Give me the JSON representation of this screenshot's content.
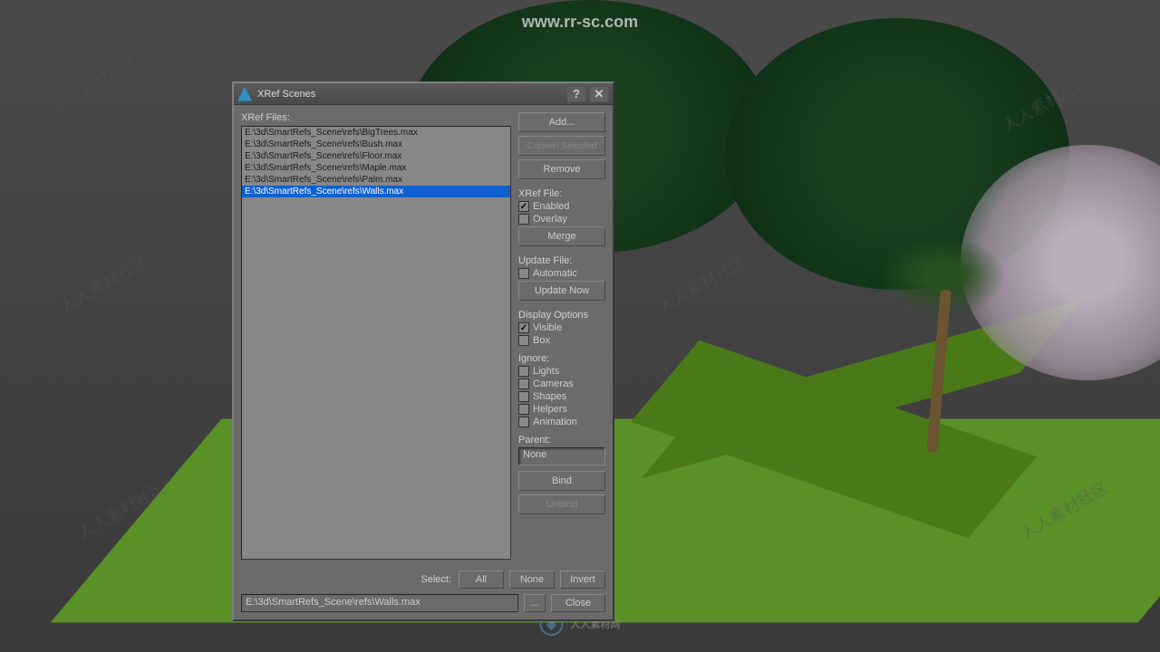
{
  "watermark_top": "www.rr-sc.com",
  "watermark_bottom": "人人素材网",
  "watermark_tile": "人人素材社区",
  "dialog": {
    "title": "XRef Scenes",
    "files_label": "XRef Files:",
    "files": [
      "E:\\3d\\SmartRefs_Scene\\refs\\BigTrees.max",
      "E:\\3d\\SmartRefs_Scene\\refs\\Bush.max",
      "E:\\3d\\SmartRefs_Scene\\refs\\Floor.max",
      "E:\\3d\\SmartRefs_Scene\\refs\\Maple.max",
      "E:\\3d\\SmartRefs_Scene\\refs\\Palm.max",
      "E:\\3d\\SmartRefs_Scene\\refs\\Walls.max"
    ],
    "selected_index": 5,
    "buttons": {
      "add": "Add...",
      "convert": "Convert Selected",
      "remove": "Remove",
      "merge": "Merge",
      "update_now": "Update Now",
      "bind": "Bind",
      "unbind": "Unbind",
      "close": "Close",
      "all": "All",
      "none": "None",
      "invert": "Invert",
      "browse": "..."
    },
    "sections": {
      "xref_file": "XRef File:",
      "update_file": "Update File:",
      "display_options": "Display Options",
      "ignore": "Ignore:",
      "parent": "Parent:",
      "select": "Select:"
    },
    "checks": {
      "enabled": {
        "label": "Enabled",
        "checked": true
      },
      "overlay": {
        "label": "Overlay",
        "checked": false
      },
      "automatic": {
        "label": "Automatic",
        "checked": false
      },
      "visible": {
        "label": "Visible",
        "checked": true
      },
      "box": {
        "label": "Box",
        "checked": false
      },
      "lights": {
        "label": "Lights",
        "checked": false
      },
      "cameras": {
        "label": "Cameras",
        "checked": false
      },
      "shapes": {
        "label": "Shapes",
        "checked": false
      },
      "helpers": {
        "label": "Helpers",
        "checked": false
      },
      "animation": {
        "label": "Animation",
        "checked": false
      }
    },
    "parent_value": "None",
    "status_path": "E:\\3d\\SmartRefs_Scene\\refs\\Walls.max"
  }
}
